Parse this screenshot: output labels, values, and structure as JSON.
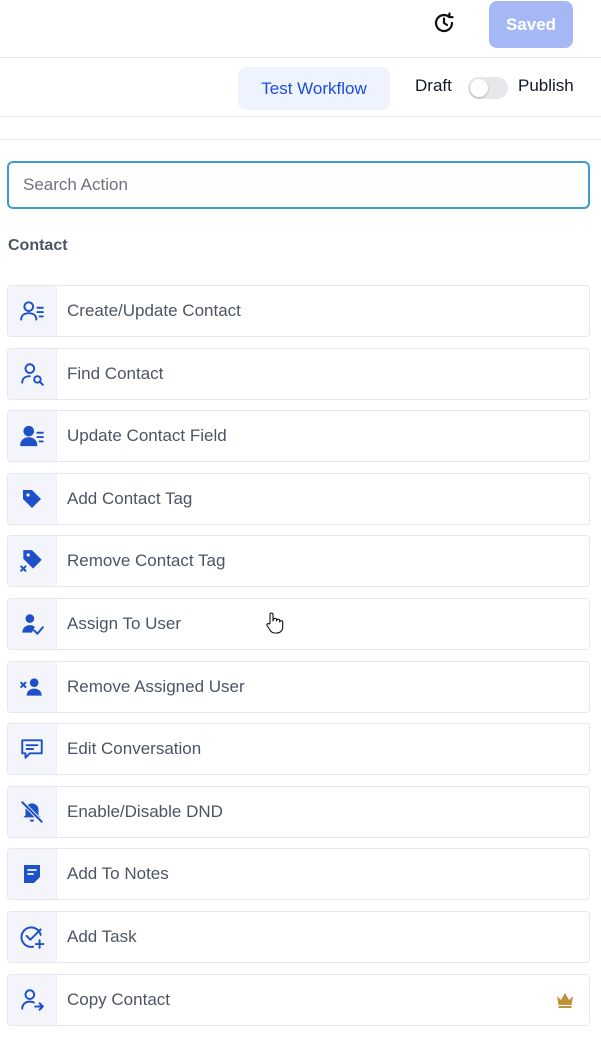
{
  "header": {
    "history_icon": "history-icon",
    "saved_label": "Saved"
  },
  "toolbar": {
    "test_label": "Test Workflow",
    "draft_label": "Draft",
    "publish_label": "Publish",
    "publish_enabled": false
  },
  "search": {
    "placeholder": "Search Action",
    "value": ""
  },
  "section": {
    "title": "Contact"
  },
  "actions": [
    {
      "label": "Create/Update Contact",
      "icon": "contact-list-icon"
    },
    {
      "label": "Find Contact",
      "icon": "find-contact-icon"
    },
    {
      "label": "Update Contact Field",
      "icon": "contact-field-icon"
    },
    {
      "label": "Add Contact Tag",
      "icon": "tag-icon"
    },
    {
      "label": "Remove Contact Tag",
      "icon": "remove-tag-icon"
    },
    {
      "label": "Assign To User",
      "icon": "assign-user-icon"
    },
    {
      "label": "Remove Assigned User",
      "icon": "remove-user-icon"
    },
    {
      "label": "Edit Conversation",
      "icon": "conversation-icon"
    },
    {
      "label": "Enable/Disable DND",
      "icon": "dnd-bell-off-icon"
    },
    {
      "label": "Add To Notes",
      "icon": "notes-icon"
    },
    {
      "label": "Add Task",
      "icon": "add-task-icon"
    },
    {
      "label": "Copy Contact",
      "icon": "copy-contact-icon",
      "premium": true
    }
  ],
  "colors": {
    "accent": "#1d4ed8",
    "icon": "#1e50c8",
    "saved_button": "#a5b8f5",
    "search_border": "#3b9cd6",
    "crown": "#c0903a"
  }
}
